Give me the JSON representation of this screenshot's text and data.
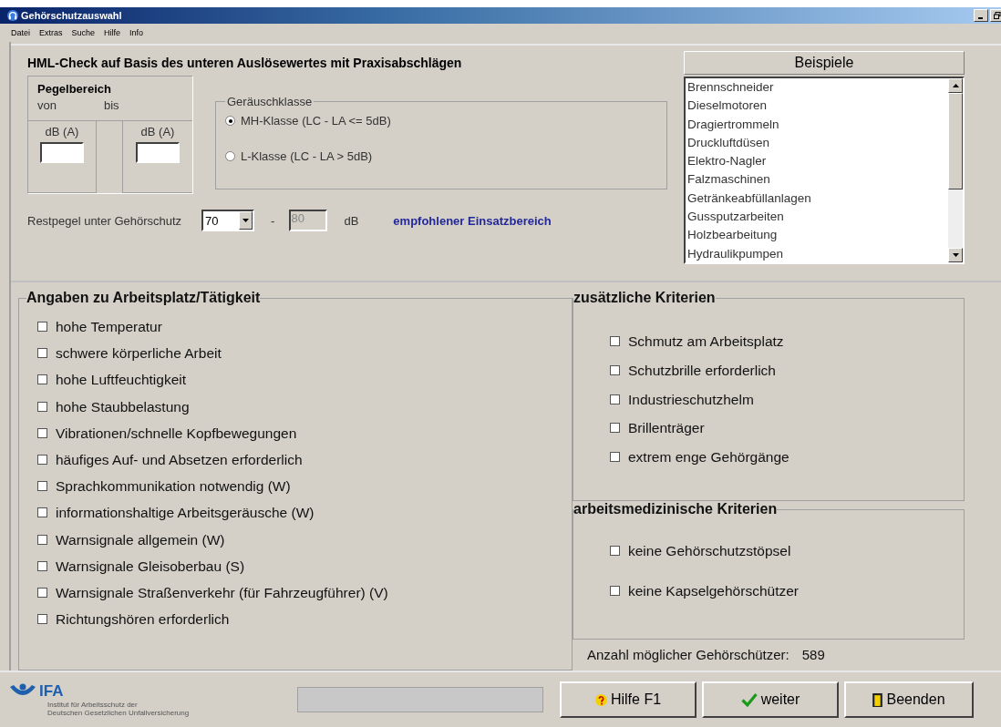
{
  "window": {
    "title": "Gehörschutzauswahl"
  },
  "menu": [
    "Datei",
    "Extras",
    "Suche",
    "Hilfe",
    "Info"
  ],
  "heading": "HML-Check auf Basis des unteren Auslösewertes mit Praxisabschlägen",
  "level_range": {
    "title": "Pegelbereich",
    "from_label": "von",
    "to_label": "bis",
    "from_unit": "dB (A)",
    "to_unit": "dB (A)"
  },
  "noise_class": {
    "title": "Geräuschklasse",
    "options": [
      {
        "label": "MH-Klasse (LC - LA <= 5dB)",
        "selected": true
      },
      {
        "label": "L-Klasse (LC - LA > 5dB)",
        "selected": false
      }
    ]
  },
  "residual": {
    "label": "Restpegel unter Gehörschutz",
    "from_value": "70",
    "dash": "-",
    "to_value": "80",
    "unit": "dB",
    "note": "empfohlener Einsatzbereich"
  },
  "examples": {
    "title": "Beispiele",
    "items": [
      "Brennschneider",
      "Dieselmotoren",
      "Dragiertrommeln",
      "Druckluftdüsen",
      "Elektro-Nagler",
      "Falzmaschinen",
      "Getränkeabfüllanlagen",
      "Gussputzarbeiten",
      "Holzbearbeitung",
      "Hydraulikpumpen"
    ]
  },
  "workplace": {
    "title": "Angaben zu Arbeitsplatz/Tätigkeit",
    "criteria": [
      {
        "label": "hohe Temperatur",
        "checked": false
      },
      {
        "label": "schwere körperliche Arbeit",
        "checked": false
      },
      {
        "label": "hohe Luftfeuchtigkeit",
        "checked": false
      },
      {
        "label": "hohe Staubbelastung",
        "checked": false
      },
      {
        "label": "Vibrationen/schnelle Kopfbewegungen",
        "checked": false
      },
      {
        "label": "häufiges Auf- und Absetzen erforderlich",
        "checked": false
      },
      {
        "label": "Sprachkommunikation notwendig (W)",
        "checked": false
      },
      {
        "label": "informationshaltige Arbeitsgeräusche (W)",
        "checked": false
      },
      {
        "label": "Warnsignale allgemein (W)",
        "checked": false
      },
      {
        "label": "Warnsignale Gleisoberbau (S)",
        "checked": false
      },
      {
        "label": "Warnsignale Straßenverkehr (für Fahrzeugführer) (V)",
        "checked": false
      },
      {
        "label": "Richtungshören erforderlich",
        "checked": false
      }
    ]
  },
  "additional": {
    "title": "zusätzliche Kriterien",
    "criteria": [
      {
        "label": "Schmutz am Arbeitsplatz",
        "checked": false
      },
      {
        "label": "Schutzbrille erforderlich",
        "checked": false
      },
      {
        "label": "Industrieschutzhelm",
        "checked": false
      },
      {
        "label": "Brillenträger",
        "checked": false
      },
      {
        "label": "extrem enge Gehörgänge",
        "checked": false
      }
    ]
  },
  "medical": {
    "title": "arbeitsmedizinische Kriterien",
    "criteria": [
      {
        "label": "keine Gehörschutzstöpsel",
        "checked": false
      },
      {
        "label": "keine Kapselgehörschützer",
        "checked": false
      }
    ]
  },
  "count": {
    "label": "Anzahl möglicher Gehörschützer:",
    "value": "589"
  },
  "footer": {
    "logo": "IFA",
    "org_lines": [
      "Institut für Arbeitsschutz der",
      "Deutschen Gesetzlichen Unfallversicherung"
    ],
    "buttons": [
      {
        "kind": "help",
        "label": "Hilfe F1"
      },
      {
        "kind": "next",
        "label": "weiter"
      },
      {
        "kind": "exit",
        "label": "Beenden"
      }
    ]
  }
}
